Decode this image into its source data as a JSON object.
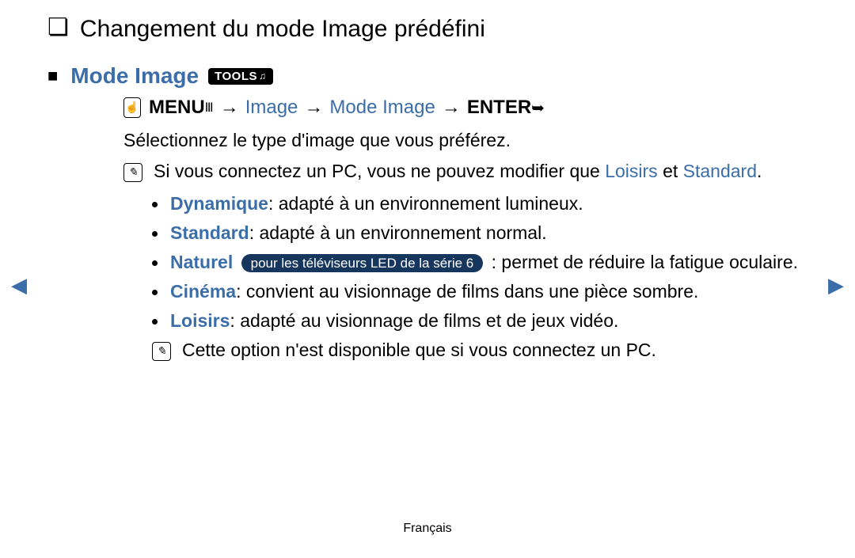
{
  "title": "Changement du mode Image prédéfini",
  "section": {
    "heading": "Mode Image",
    "tools_label": "TOOLS"
  },
  "breadcrumb": {
    "menu": "MENU",
    "step1": "Image",
    "step2": "Mode Image",
    "enter": "ENTER",
    "arrow": "→"
  },
  "intro": "Sélectionnez le type d'image que vous préférez.",
  "note1": {
    "prefix": "Si vous connectez un PC, vous ne pouvez modifier que ",
    "link1": "Loisirs",
    "mid": " et ",
    "link2": "Standard",
    "suffix": "."
  },
  "modes": [
    {
      "name": "Dynamique",
      "desc": ": adapté à un environnement lumineux."
    },
    {
      "name": "Standard",
      "desc": ": adapté à un environnement normal."
    },
    {
      "name": "Naturel",
      "badge": "pour les téléviseurs LED de la série 6",
      "desc": ": permet de réduire la fatigue oculaire."
    },
    {
      "name": "Cinéma",
      "desc": ": convient au visionnage de films dans une pièce sombre."
    },
    {
      "name": "Loisirs",
      "desc": ": adapté au visionnage de films et de jeux vidéo."
    }
  ],
  "note2": "Cette option n'est disponible que si vous connectez un PC.",
  "footer": "Français"
}
